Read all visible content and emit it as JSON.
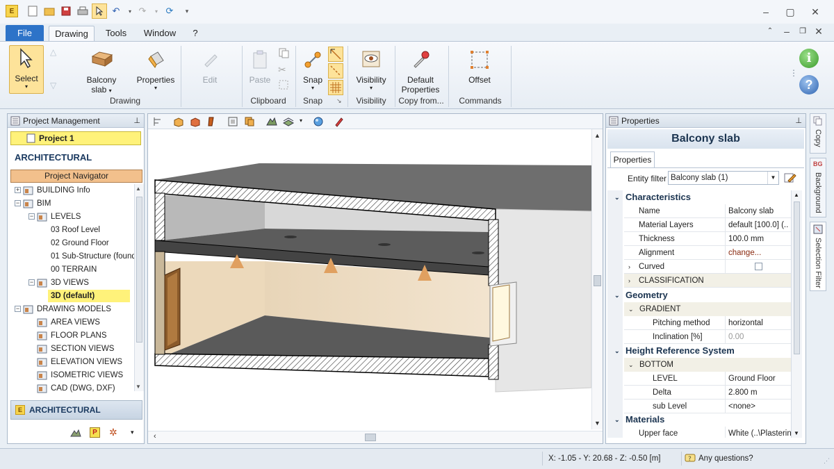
{
  "menu": {
    "file": "File",
    "tabs": [
      "Drawing",
      "Tools",
      "Window",
      "?"
    ]
  },
  "ribbon": {
    "select": "Select",
    "balcony_slab": [
      "Balcony",
      "slab"
    ],
    "properties": "Properties",
    "edit": "Edit",
    "paste": "Paste",
    "snap": "Snap",
    "visibility": "Visibility",
    "default_properties": [
      "Default",
      "Properties"
    ],
    "offset": "Offset",
    "groups": {
      "drawing": "Drawing",
      "clipboard": "Clipboard",
      "snap": "Snap",
      "visibility": "Visibility",
      "copy_from": "Copy from...",
      "commands": "Commands"
    }
  },
  "project": {
    "panel_title": "Project Management",
    "project_name": "Project 1",
    "section_title": "ARCHITECTURAL",
    "navigator": "Project Navigator",
    "tree": [
      {
        "label": "BUILDING Info",
        "level": 0,
        "exp": "+"
      },
      {
        "label": "BIM",
        "level": 0,
        "exp": "−"
      },
      {
        "label": "LEVELS",
        "level": 1,
        "exp": "−"
      },
      {
        "label": "03 Roof Level",
        "level": 2
      },
      {
        "label": "02 Ground Floor",
        "level": 2
      },
      {
        "label": "01 Sub-Structure (found",
        "level": 2
      },
      {
        "label": "00 TERRAIN",
        "level": 2
      },
      {
        "label": "3D VIEWS",
        "level": 1,
        "exp": "−"
      },
      {
        "label": "3D (default)",
        "level": 2,
        "selected": true
      },
      {
        "label": "DRAWING MODELS",
        "level": 0,
        "exp": "−"
      },
      {
        "label": "AREA VIEWS",
        "level": 1
      },
      {
        "label": "FLOOR PLANS",
        "level": 1
      },
      {
        "label": "SECTION VIEWS",
        "level": 1
      },
      {
        "label": "ELEVATION VIEWS",
        "level": 1
      },
      {
        "label": "ISOMETRIC VIEWS",
        "level": 1
      },
      {
        "label": "CAD (DWG, DXF)",
        "level": 1
      }
    ],
    "bottom_label": "ARCHITECTURAL"
  },
  "properties": {
    "panel_title": "Properties",
    "entity_title": "Balcony slab",
    "tab": "Properties",
    "filter_label": "Entity filter",
    "filter_value": "Balcony slab (1)",
    "sections": {
      "characteristics": "Characteristics",
      "geometry": "Geometry",
      "height_ref": "Height Reference System",
      "materials": "Materials"
    },
    "rows": {
      "name": [
        "Name",
        "Balcony slab"
      ],
      "material_layers": [
        "Material Layers",
        "default [100.0]  (.."
      ],
      "thickness": [
        "Thickness",
        "100.0 mm"
      ],
      "alignment": [
        "Alignment",
        "change..."
      ],
      "curved": [
        "Curved",
        ""
      ],
      "classification": "CLASSIFICATION",
      "gradient": "GRADIENT",
      "pitching": [
        "Pitching method",
        "horizontal"
      ],
      "inclination": [
        "Inclination  [%]",
        "0.00"
      ],
      "bottom": "BOTTOM",
      "level": [
        "LEVEL",
        "Ground Floor"
      ],
      "delta": [
        "Delta",
        "2.800 m"
      ],
      "sublevel": [
        "sub Level",
        "<none>"
      ],
      "upper_face": [
        "Upper face",
        "White   (..\\Plasterin"
      ]
    }
  },
  "side_tabs": [
    "Copy",
    "Background",
    "Selection Filter"
  ],
  "status": {
    "coords": "X: -1.05 - Y: 20.68 - Z: -0.50 [m]",
    "help": "Any questions?"
  },
  "colors": {
    "accent": "#2d73c8",
    "selected": "#fff27a",
    "navigator": "#f2c08c"
  }
}
